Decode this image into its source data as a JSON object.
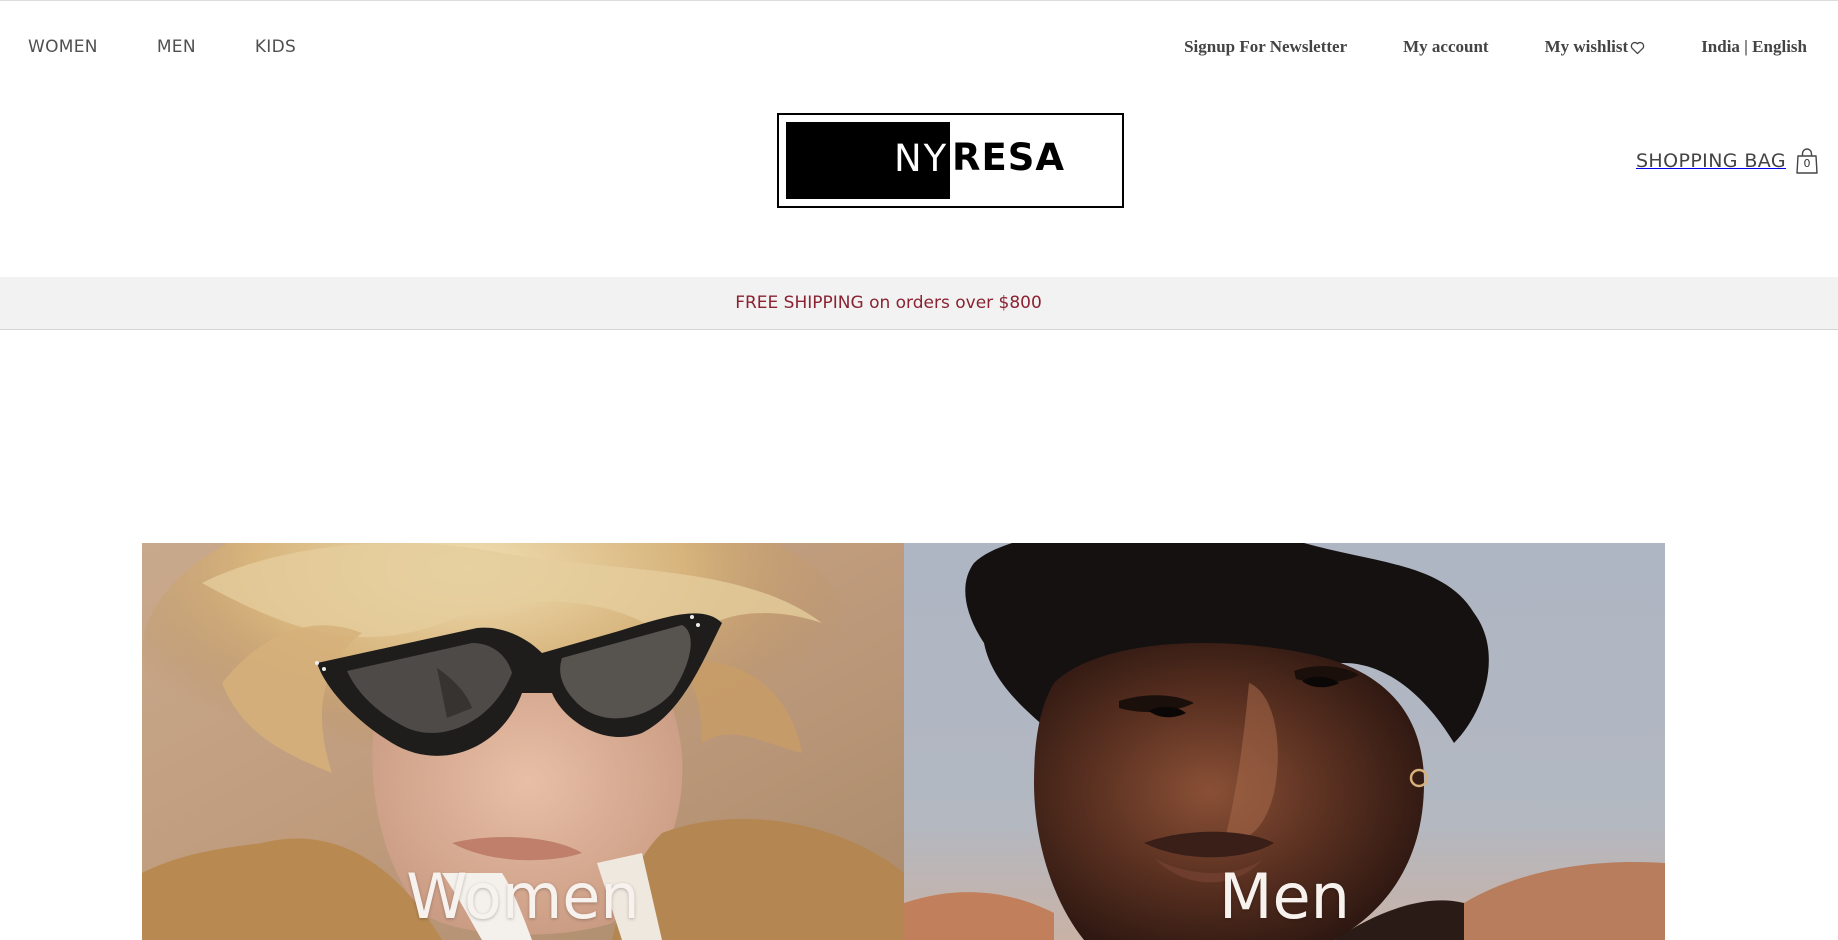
{
  "nav": {
    "left": [
      "WOMEN",
      "MEN",
      "KIDS"
    ],
    "newsletter": "Signup For Newsletter",
    "account": "My account",
    "wishlist": "My wishlist",
    "locale": "India | English"
  },
  "logo": {
    "part1": "NY",
    "part2": "RESA"
  },
  "cart": {
    "label": "SHOPPING BAG",
    "count": "0"
  },
  "promo": {
    "text": "FREE SHIPPING on orders over $800",
    "color": "#8a2232"
  },
  "hero": {
    "women_label": "Women",
    "men_label": "Men"
  },
  "icons": {
    "wishlist": "heart-icon",
    "cart": "shopping-bag-icon"
  }
}
